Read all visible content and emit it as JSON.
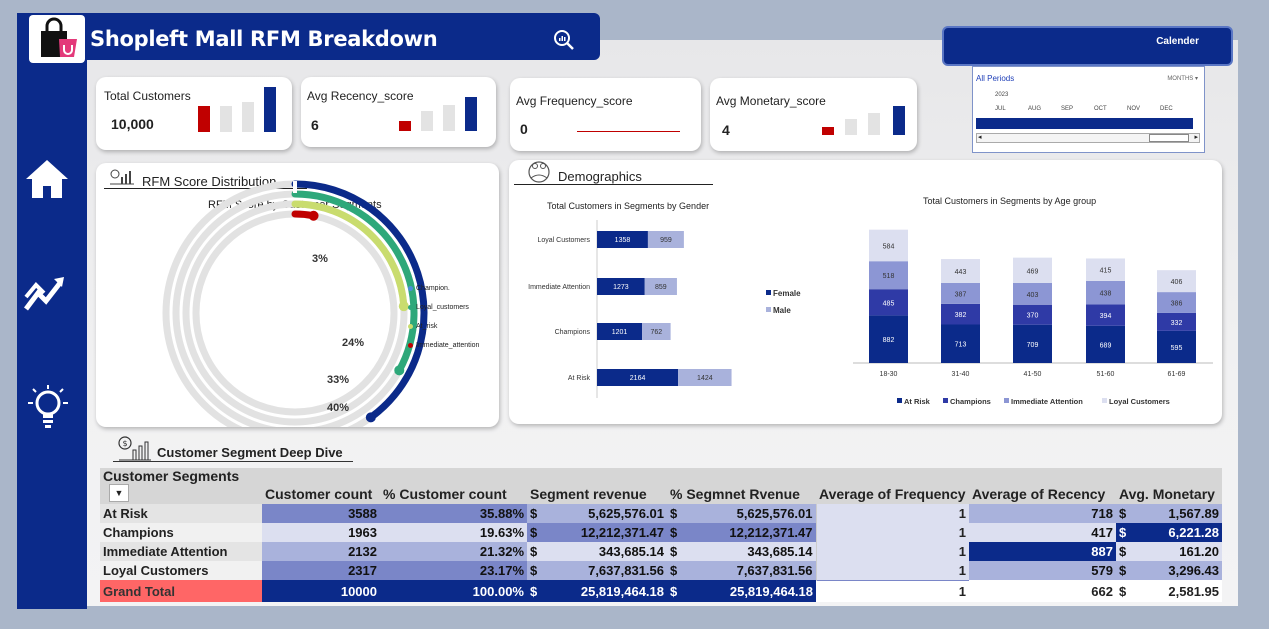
{
  "header": {
    "title": "Shopleft Mall RFM Breakdown"
  },
  "calendar": {
    "button_label": "Calender",
    "period_label": "All Periods",
    "granularity": "MONTHS",
    "year": "2023",
    "months": [
      "JUL",
      "AUG",
      "SEP",
      "OCT",
      "NOV",
      "DEC"
    ]
  },
  "kpis": [
    {
      "label": "Total Customers",
      "value": "10,000"
    },
    {
      "label": "Avg Recency_score",
      "value": "6"
    },
    {
      "label": "Avg Frequency_score",
      "value": "0"
    },
    {
      "label": "Avg Monetary_score",
      "value": "4"
    }
  ],
  "rfm_section": {
    "heading": "RFM Score Distribution",
    "chart_title": "RFM Score by Customer Segments",
    "legend": [
      "Champion.",
      "Loyal_customers",
      "At_risk",
      "Immediate_attention"
    ]
  },
  "demographics": {
    "heading": "Demographics",
    "gender_title": "Total Customers in Segments by Gender",
    "gender_legend": [
      "Female",
      "Male"
    ],
    "age_title": "Total Customers in Segments by Age group",
    "age_legend": [
      "At Risk",
      "Champions",
      "Immediate Attention",
      "Loyal Customers"
    ]
  },
  "deep_dive": {
    "heading": "Customer Segment Deep Dive",
    "columns": [
      "Customer Segments",
      "Customer count",
      "% Customer count",
      "Segment revenue",
      "% Segmnet Rvenue",
      "Average of Frequency",
      "Average of Recency",
      "Avg. Monetary"
    ],
    "rows": [
      {
        "segment": "At Risk",
        "count": "3588",
        "pct": "35.88%",
        "rev_sym": "$",
        "rev": "5,625,576.01",
        "prev_sym": "$",
        "prev": "5,625,576.01",
        "freq": "1",
        "rec": "718",
        "mon_sym": "$",
        "mon": "1,567.89"
      },
      {
        "segment": "Champions",
        "count": "1963",
        "pct": "19.63%",
        "rev_sym": "$",
        "rev": "12,212,371.47",
        "prev_sym": "$",
        "prev": "12,212,371.47",
        "freq": "1",
        "rec": "417",
        "mon_sym": "$",
        "mon": "6,221.28"
      },
      {
        "segment": "Immediate Attention",
        "count": "2132",
        "pct": "21.32%",
        "rev_sym": "$",
        "rev": "343,685.14",
        "prev_sym": "$",
        "prev": "343,685.14",
        "freq": "1",
        "rec": "887",
        "mon_sym": "$",
        "mon": "161.20"
      },
      {
        "segment": "Loyal Customers",
        "count": "2317",
        "pct": "23.17%",
        "rev_sym": "$",
        "rev": "7,637,831.56",
        "prev_sym": "$",
        "prev": "7,637,831.56",
        "freq": "1",
        "rec": "579",
        "mon_sym": "$",
        "mon": "3,296.43"
      }
    ],
    "total": {
      "segment": "Grand Total",
      "count": "10000",
      "pct": "100.00%",
      "rev_sym": "$",
      "rev": "25,819,464.18",
      "prev_sym": "$",
      "prev": "25,819,464.18",
      "freq": "1",
      "rec": "662",
      "mon_sym": "$",
      "mon": "2,581.95"
    }
  },
  "colors": {
    "navy": "#0b2a8a",
    "mid": "#3b4fb0",
    "light": "#a9b2dc",
    "pale": "#dcdff0",
    "red": "#c00000",
    "grand_total": "#ff6666"
  },
  "chart_data": [
    {
      "type": "radial-bar",
      "title": "RFM Score by Customer Segments",
      "categories": [
        "Champion.",
        "Loyal_customers",
        "At_risk",
        "Immediate_attention"
      ],
      "values_pct": [
        40,
        33,
        24,
        3
      ],
      "data_labels": [
        "40%",
        "33%",
        "24%",
        "3%"
      ]
    },
    {
      "type": "bar",
      "orientation": "horizontal",
      "stacked": true,
      "title": "Total Customers in Segments by Gender",
      "categories": [
        "Loyal Customers",
        "Immediate Attention",
        "Champions",
        "At Risk"
      ],
      "series": [
        {
          "name": "Female",
          "values": [
            1358,
            1273,
            1201,
            2164
          ]
        },
        {
          "name": "Male",
          "values": [
            959,
            859,
            762,
            1424
          ]
        }
      ]
    },
    {
      "type": "bar",
      "stacked": true,
      "title": "Total Customers in Segments by Age group",
      "categories": [
        "18-30",
        "31-40",
        "41-50",
        "51-60",
        "61-69"
      ],
      "series": [
        {
          "name": "At Risk",
          "values": [
            882,
            713,
            709,
            689,
            595
          ]
        },
        {
          "name": "Champions",
          "values": [
            485,
            382,
            370,
            394,
            332
          ]
        },
        {
          "name": "Immediate Attention",
          "values": [
            518,
            387,
            403,
            438,
            386
          ]
        },
        {
          "name": "Loyal Customers",
          "values": [
            584,
            443,
            469,
            415,
            406
          ]
        }
      ]
    }
  ]
}
